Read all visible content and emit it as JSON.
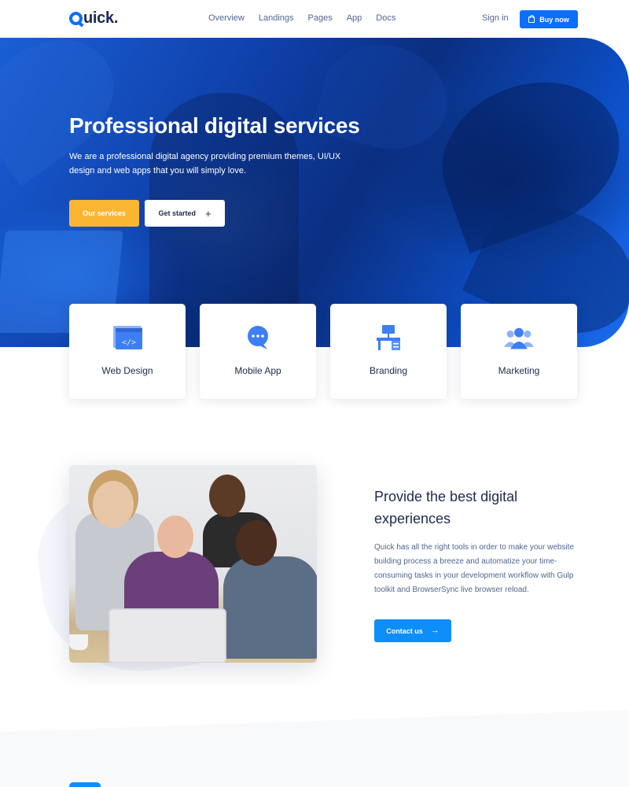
{
  "brand": {
    "name": "uick.",
    "accent_color": "#0d6efd"
  },
  "nav": {
    "links": [
      "Overview",
      "Landings",
      "Pages",
      "App",
      "Docs"
    ],
    "signin": "Sign in",
    "buy_now": "Buy now"
  },
  "hero": {
    "title": "Professional digital services",
    "subtitle": "We are a professional digital agency providing premium themes, UI/UX design and web apps that you will simply love.",
    "primary_button": "Our services",
    "secondary_button": "Get started",
    "primary_color": "#fab633"
  },
  "services": [
    {
      "label": "Web Design",
      "icon": "code-window-icon"
    },
    {
      "label": "Mobile App",
      "icon": "chat-bubble-icon"
    },
    {
      "label": "Branding",
      "icon": "desk-icon"
    },
    {
      "label": "Marketing",
      "icon": "team-icon"
    }
  ],
  "feature": {
    "title": "Provide the best digital experiences",
    "text": "Quick has all the right tools in order to make your website building process a breeze and automatize your time-consuming tasks in your development workflow with Gulp toolkit and BrowserSync live browser reload.",
    "button": "Contact us",
    "button_color": "#0d8ef9"
  }
}
